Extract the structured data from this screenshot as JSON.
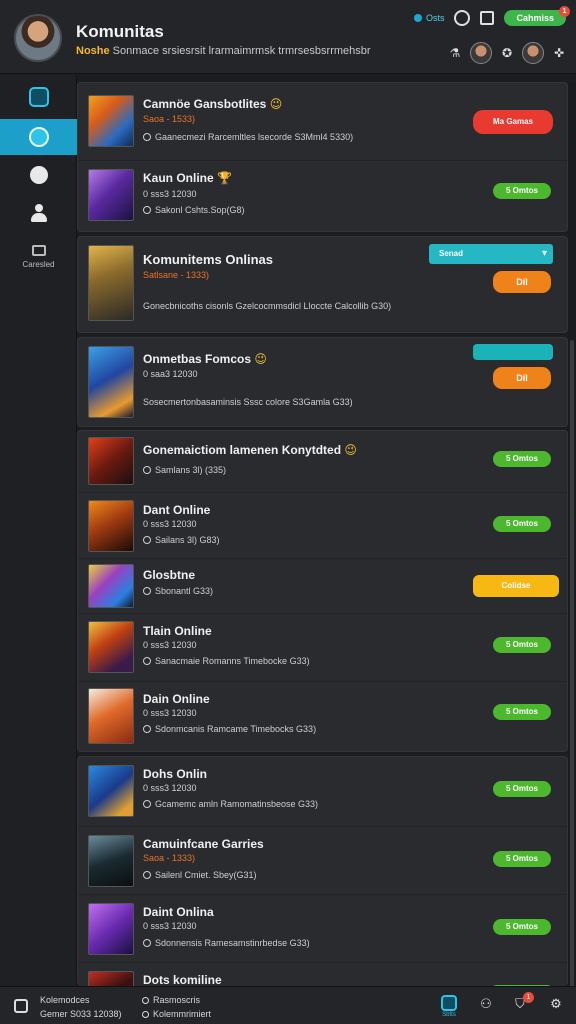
{
  "header": {
    "title": "Komunitas",
    "level": "Noshe",
    "subtitle": "Sonmace srsiesrsit lrarmaimrmsk trmrsesbsrrmehsbr",
    "status_label": "Osts",
    "action_label": "Cahmiss",
    "badge_count": "1"
  },
  "sidebar": {
    "items": [
      {
        "name": "home",
        "label": ""
      },
      {
        "name": "community",
        "label": ""
      },
      {
        "name": "messages",
        "label": ""
      },
      {
        "name": "profile",
        "label": ""
      },
      {
        "name": "games",
        "label": "Caresled"
      }
    ]
  },
  "feed": {
    "rows": [
      {
        "title": "Camnöe Gansbotlites",
        "emoji": "😉",
        "meta": "Saoa - 1533)",
        "meta_orange": true,
        "desc": "Gaanecmezi Rarcemltles lsecorde S3Mml4 5330)",
        "button": "Ma Gamas",
        "button_style": "red"
      },
      {
        "title": "Kaun Online",
        "emoji": "🏆",
        "meta": "0 sss3 12030",
        "meta_orange": false,
        "desc": "Sakonl Cshts.Sop(G8)",
        "button": "5 Omtos",
        "button_style": "green"
      },
      {
        "title": "Komunitems Onlinas",
        "emoji": "",
        "meta": "Satlsane - 1333)",
        "meta_orange": true,
        "desc": "Gonecbnicoths cisonls Gzelcocmmsdicl Lloccte Calcollib G30)",
        "button": "Dil",
        "button_style": "orange",
        "select_label": "Senad"
      },
      {
        "title": "Onmetbas Fomcos",
        "emoji": "😉",
        "meta": "0 saa3 12030",
        "meta_orange": false,
        "desc": "Sosecmertonbasaminsis Sssc colore S3Gamla G33)",
        "button": "Dil",
        "button_style": "orange"
      },
      {
        "title": "Gonemaictiom lamenen Konytdted",
        "emoji": "😉",
        "meta": "",
        "meta_orange": false,
        "desc": "Samlans 3l) (335)",
        "button": "5 Omtos",
        "button_style": "green"
      },
      {
        "title": "Dant Online",
        "emoji": "",
        "meta": "0 sss3 12030",
        "meta_orange": false,
        "desc": "Sailans 3l) G83)",
        "button": "5 Omtos",
        "button_style": "green"
      },
      {
        "title": "Glosbtne",
        "emoji": "",
        "meta": "",
        "meta_orange": false,
        "desc": "Sbonantl G33)",
        "button": "Colidse",
        "button_style": "yellow"
      },
      {
        "title": "Tlain Online",
        "emoji": "",
        "meta": "0 sss3 12030",
        "meta_orange": false,
        "desc": "Sanacmaie Romanns Timebocke G33)",
        "button": "5 Omtos",
        "button_style": "green"
      },
      {
        "title": "Dain Online",
        "emoji": "",
        "meta": "0 sss3 12030",
        "meta_orange": false,
        "desc": "Sdonmcanis Ramcame Timebocks G33)",
        "button": "5 Omtos",
        "button_style": "green"
      },
      {
        "title": "Dohs Onlin",
        "emoji": "",
        "meta": "0 sss3 12030",
        "meta_orange": false,
        "desc": "Gcamemc amln Ramomatinsbeose G33)",
        "button": "5 Omtos",
        "button_style": "green"
      },
      {
        "title": "Camuinfcane Garries",
        "emoji": "",
        "meta": "Saoa - 1333)",
        "meta_orange": true,
        "desc": "Sailenl Cmiet. Sbey(G31)",
        "button": "5 Omtos",
        "button_style": "green"
      },
      {
        "title": "Daint Onlina",
        "emoji": "",
        "meta": "0 sss3 12030",
        "meta_orange": false,
        "desc": "Sdonnensis Ramesamstinrbedse G33)",
        "button": "5 Omtos",
        "button_style": "green"
      },
      {
        "title": "Dots komiline",
        "emoji": "",
        "meta": "",
        "meta_orange": false,
        "desc": "",
        "button": "",
        "button_style": "green"
      }
    ],
    "panel2_extra_button": ""
  },
  "bottom": {
    "left_title": "Kolemodces",
    "left_sub": "Gemer S033 12038)",
    "mid_1": "Rasmoscris",
    "mid_2": "Kolemmrimiert",
    "nav_label": "Sbtts",
    "badge": "1"
  }
}
